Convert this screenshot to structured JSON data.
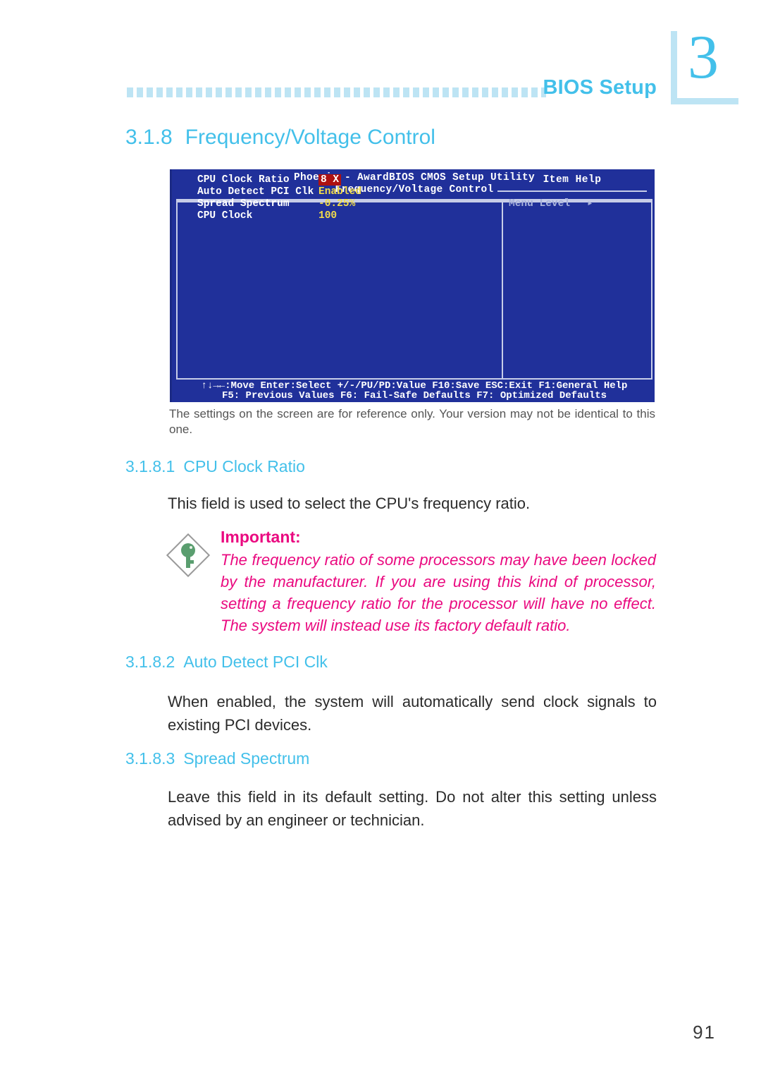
{
  "header": {
    "title": "BIOS Setup",
    "chapter_number": "3",
    "accent_color": "#43c0ea",
    "rule_color": "#bde4f4"
  },
  "section": {
    "number": "3.1.8",
    "title": "Frequency/Voltage Control"
  },
  "bios": {
    "title_line1": "Phoenix - AwardBIOS CMOS Setup Utility",
    "title_line2": "Frequency/Voltage Control",
    "items": [
      {
        "label": "CPU Clock Ratio",
        "value": "8 X",
        "highlighted": true
      },
      {
        "label": "Auto Detect PCI Clk",
        "value": "Enabled",
        "highlighted": false
      },
      {
        "label": "Spread Spectrum",
        "value": "-0.25%",
        "highlighted": false
      },
      {
        "label": "CPU Clock",
        "value": "100",
        "highlighted": false
      }
    ],
    "item_help_title": "Item Help",
    "menu_level_label": "Menu Level",
    "menu_level_arrow": "▸",
    "footer_line1": "↑↓→←:Move   Enter:Select   +/-/PU/PD:Value   F10:Save   ESC:Exit   F1:General Help",
    "footer_line2": "F5: Previous Values      F6: Fail-Safe Defaults      F7: Optimized Defaults",
    "screen_bg": "#20309a",
    "value_color": "#f2dc4a",
    "highlight_bg": "#ad1111"
  },
  "caption": "The settings on the screen are for reference only. Your version may not be identical to this one.",
  "subsections": {
    "cpu_clock_ratio": {
      "number": "3.1.8.1",
      "title": "CPU Clock Ratio",
      "body": "This field is used to select the CPU's frequency ratio."
    },
    "auto_detect_pci_clk": {
      "number": "3.1.8.2",
      "title": "Auto Detect PCI Clk",
      "body": "When enabled, the system will automatically send clock signals to existing PCI devices."
    },
    "spread_spectrum": {
      "number": "3.1.8.3",
      "title": "Spread Spectrum",
      "body": "Leave this field in its default setting. Do not alter this setting unless advised by an engineer or technician."
    }
  },
  "note": {
    "title": "Important:",
    "body": "The frequency ratio of some processors may have been locked by the manufacturer. If you are using this kind of processor, setting a frequency ratio for the processor will have no effect. The system will instead use its factory default ratio.",
    "color": "#ea0a80",
    "icon": "key-icon"
  },
  "page_number": "91"
}
